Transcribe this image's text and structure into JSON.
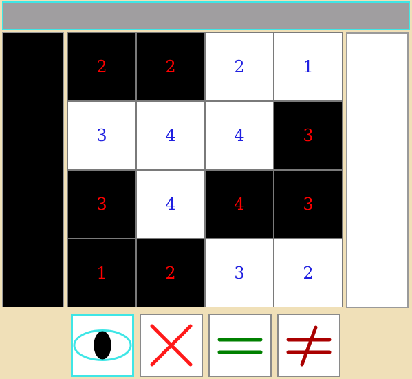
{
  "header": {
    "title": ""
  },
  "grid": {
    "rows": [
      [
        {
          "value": "2",
          "shade": "black"
        },
        {
          "value": "2",
          "shade": "black"
        },
        {
          "value": "2",
          "shade": "white"
        },
        {
          "value": "1",
          "shade": "white"
        }
      ],
      [
        {
          "value": "3",
          "shade": "white"
        },
        {
          "value": "4",
          "shade": "white"
        },
        {
          "value": "4",
          "shade": "white"
        },
        {
          "value": "3",
          "shade": "black"
        }
      ],
      [
        {
          "value": "3",
          "shade": "black"
        },
        {
          "value": "4",
          "shade": "white"
        },
        {
          "value": "4",
          "shade": "black"
        },
        {
          "value": "3",
          "shade": "black"
        }
      ],
      [
        {
          "value": "1",
          "shade": "black"
        },
        {
          "value": "2",
          "shade": "black"
        },
        {
          "value": "3",
          "shade": "white"
        },
        {
          "value": "2",
          "shade": "white"
        }
      ]
    ]
  },
  "toolbar": {
    "tools": [
      {
        "name": "eye-icon",
        "selected": true
      },
      {
        "name": "cross-icon",
        "selected": false
      },
      {
        "name": "equals-icon",
        "selected": false
      },
      {
        "name": "not-equal-icon",
        "selected": false
      }
    ]
  },
  "colors": {
    "background": "#f0e0b8",
    "accent": "#3fe6e6",
    "number_on_black": "#ff0000",
    "number_on_white": "#2020e0",
    "cross": "#ff1a1a",
    "equals": "#008000",
    "not_equal": "#aa0000"
  }
}
